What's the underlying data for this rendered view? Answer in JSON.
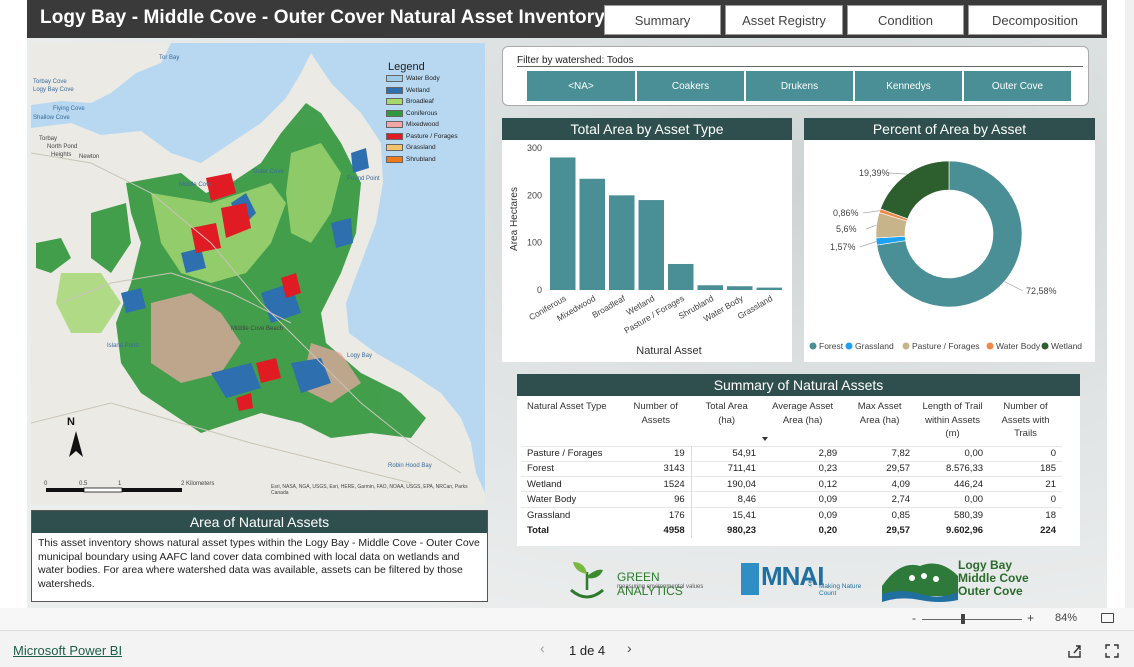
{
  "report": {
    "title": "Logy Bay - Middle Cove - Outer Cover Natural Asset Inventory",
    "nav": [
      "Summary",
      "Asset Registry",
      "Condition",
      "Decomposition"
    ]
  },
  "map": {
    "legend_title": "Legend",
    "legend": [
      {
        "label": "Water Body",
        "color": "#9ecbe8"
      },
      {
        "label": "Wetland",
        "color": "#2e6fb0"
      },
      {
        "label": "Broadleaf",
        "color": "#a6d96a"
      },
      {
        "label": "Coniferous",
        "color": "#2f9a3c"
      },
      {
        "label": "Mixedwood",
        "color": "#f4a6a6"
      },
      {
        "label": "Pasture / Forages",
        "color": "#e01b24"
      },
      {
        "label": "Grassland",
        "color": "#f2c36b"
      },
      {
        "label": "Shrubland",
        "color": "#f07a1a"
      }
    ],
    "place_labels": [
      "Tor Bay",
      "Torbay Cove",
      "Logy Bay Cove",
      "Flying Cove",
      "Shallow Cove",
      "Torbay",
      "North Pond",
      "Heights",
      "Newton",
      "Middle Cove",
      "Outer Cove",
      "Middle Cove Beach",
      "Pound Point",
      "Logy Bay",
      "Island Pond",
      "Robin Hood Bay"
    ],
    "scale_ticks": [
      "0",
      "0.5",
      "1",
      "2 Kilometers"
    ],
    "attribution": "Esri, NASA, NGA, USGS, Esri, HERE, Garmin, FAO, NOAA, USGS, EPA, NRCan, Parks Canada",
    "north": "N"
  },
  "about": {
    "title": "Area of Natural Assets",
    "text": "This asset inventory shows natural asset types within the Logy Bay - Middle Cove - Outer Cove municipal boundary using AAFC land cover data combined with local data on wetlands and water bodies. For area where watershed data was available, assets can be filtered by those watersheds."
  },
  "filter": {
    "label": "Filter by watershed: Todos",
    "options": [
      "<NA>",
      "Coakers",
      "Drukens",
      "Kennedys",
      "Outer Cove"
    ]
  },
  "bar_panel_title": "Total Area by Asset Type",
  "donut_panel_title": "Percent of Area by Asset",
  "chart_data": [
    {
      "type": "bar",
      "title": "Total Area by Asset Type",
      "xlabel": "Natural Asset",
      "ylabel": "Area Hectares",
      "categories": [
        "Coniferous",
        "Mixedwood",
        "Broadleaf",
        "Wetland",
        "Pasture / Forages",
        "Shrubland",
        "Water Body",
        "Grassland"
      ],
      "values": [
        280,
        235,
        200,
        190,
        55,
        10,
        8,
        5
      ],
      "ylim": [
        0,
        300
      ],
      "yticks": [
        "0",
        "100",
        "200",
        "300"
      ],
      "color": "#4a8f95"
    },
    {
      "type": "pie",
      "title": "Percent of Area by Asset",
      "labels": [
        "Forest",
        "Grassland",
        "Pasture / Forages",
        "Water Body",
        "Wetland"
      ],
      "values": [
        72.58,
        1.57,
        5.6,
        0.86,
        19.39
      ],
      "value_labels": [
        "72,58%",
        "1,57%",
        "5,6%",
        "0,86%",
        "19,39%"
      ],
      "colors": [
        "#4a8f95",
        "#1da1f2",
        "#c8b48a",
        "#f08a4b",
        "#2d5e2e"
      ],
      "legend_position": "bottom"
    }
  ],
  "summary": {
    "title": "Summary of Natural Assets",
    "columns": [
      "Natural Asset Type",
      "Number of Assets",
      "Total Area (ha)",
      "Average Asset Area (ha)",
      "Max Asset Area (ha)",
      "Length of Trail within Assets (m)",
      "Number of Assets with Trails"
    ],
    "rows": [
      [
        "Pasture / Forages",
        "19",
        "54,91",
        "2,89",
        "7,82",
        "0,00",
        "0"
      ],
      [
        "Forest",
        "3143",
        "711,41",
        "0,23",
        "29,57",
        "8.576,33",
        "185"
      ],
      [
        "Wetland",
        "1524",
        "190,04",
        "0,12",
        "4,09",
        "446,24",
        "21"
      ],
      [
        "Water Body",
        "96",
        "8,46",
        "0,09",
        "2,74",
        "0,00",
        "0"
      ],
      [
        "Grassland",
        "176",
        "15,41",
        "0,09",
        "0,85",
        "580,39",
        "18"
      ]
    ],
    "total": [
      "Total",
      "4958",
      "980,23",
      "0,20",
      "29,57",
      "9.602,96",
      "224"
    ]
  },
  "logos": {
    "green_analytics": "GREEN ANALYTICS",
    "green_analytics_sub": "measuring environmental values",
    "mnai": "MNAI",
    "mnai_suffix": ".ca",
    "mnai_sub": "Making Nature Count",
    "town_lines": [
      "Logy Bay",
      "Middle Cove",
      "Outer Cove"
    ]
  },
  "viewer": {
    "zoom": "84%",
    "zoom_minus": "-",
    "zoom_plus": "+",
    "brand": "Microsoft Power BI",
    "page": "1 de 4"
  }
}
